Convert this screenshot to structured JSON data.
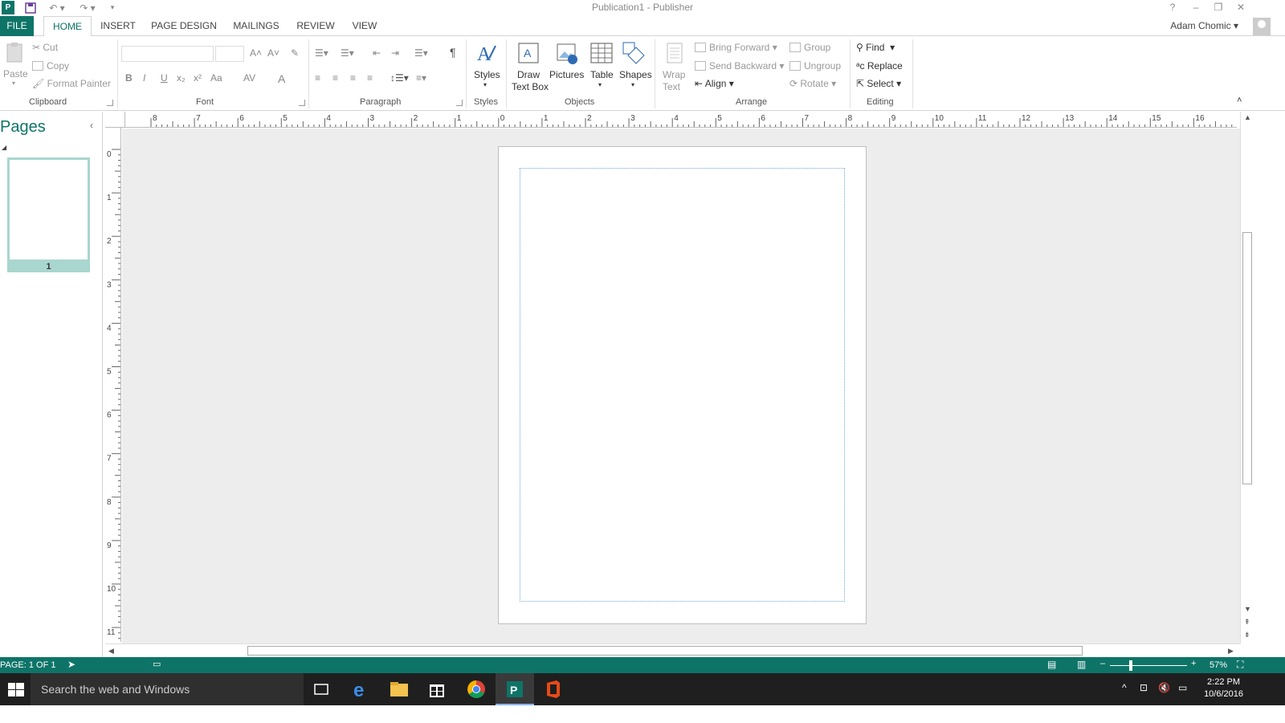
{
  "window": {
    "title": "Publication1 - Publisher",
    "help": "?",
    "minimize": "–",
    "restore": "❐",
    "close": "✕"
  },
  "tabs": [
    "FILE",
    "HOME",
    "INSERT",
    "PAGE DESIGN",
    "MAILINGS",
    "REVIEW",
    "VIEW"
  ],
  "active_tab": "HOME",
  "user": {
    "name": "Adam Chomic"
  },
  "ribbon": {
    "clipboard": {
      "paste": "Paste",
      "cut": "Cut",
      "copy": "Copy",
      "format_painter": "Format Painter",
      "label": "Clipboard"
    },
    "font": {
      "label": "Font",
      "bold": "B",
      "italic": "I",
      "underline": "U",
      "subscript": "x₂",
      "superscript": "x²",
      "case": "Aa",
      "spacing": "AV",
      "color": "A",
      "grow": "A˄",
      "shrink": "A˅"
    },
    "paragraph": {
      "label": "Paragraph",
      "pilcrow": "¶"
    },
    "styles": {
      "button": "Styles",
      "label": "Styles"
    },
    "objects": {
      "draw_text_box_1": "Draw",
      "draw_text_box_2": "Text Box",
      "pictures": "Pictures",
      "table": "Table",
      "shapes": "Shapes",
      "label": "Objects"
    },
    "arrange": {
      "wrap_text_1": "Wrap",
      "wrap_text_2": "Text",
      "bring_forward": "Bring Forward",
      "send_backward": "Send Backward",
      "align": "Align",
      "group": "Group",
      "ungroup": "Ungroup",
      "rotate": "Rotate",
      "label": "Arrange"
    },
    "editing": {
      "find": "Find",
      "replace": "Replace",
      "select": "Select",
      "label": "Editing"
    }
  },
  "pages_pane": {
    "title": "Pages",
    "page_number": "1"
  },
  "rulers": {
    "horizontal_labels": [
      "8",
      "7",
      "6",
      "5",
      "4",
      "3",
      "2",
      "1",
      "0",
      "1",
      "2",
      "3",
      "4",
      "5",
      "6",
      "7",
      "8",
      "9",
      "10",
      "11",
      "12",
      "13",
      "14",
      "15",
      "16",
      "1"
    ],
    "vertical_labels": [
      "0",
      "1",
      "2",
      "3",
      "4",
      "5",
      "6",
      "7",
      "8",
      "9",
      "10",
      "11"
    ]
  },
  "statusbar": {
    "page": "PAGE: 1 OF 1",
    "zoom": "57%",
    "zoom_minus": "–",
    "zoom_plus": "+"
  },
  "taskbar": {
    "search_placeholder": "Search the web and Windows",
    "time": "2:22 PM",
    "date": "10/6/2016"
  },
  "colors": {
    "accent": "#0e7468",
    "guide": "#6fa7d8",
    "workspace": "#ededed"
  }
}
